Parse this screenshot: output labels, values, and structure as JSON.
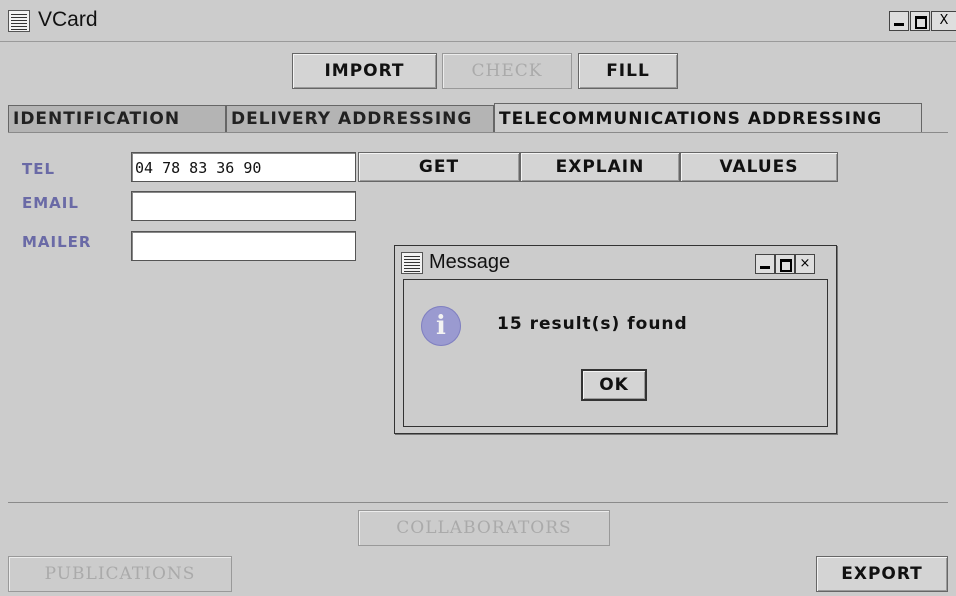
{
  "window": {
    "title": "VCard",
    "controls": [
      "_",
      "□",
      "X"
    ]
  },
  "toolbar": {
    "import": "IMPORT",
    "check": "CHECK",
    "fill": "FILL"
  },
  "tabs": [
    {
      "label": "IDENTIFICATION",
      "active": false
    },
    {
      "label": "DELIVERY ADDRESSING",
      "active": false
    },
    {
      "label": "TELECOMMUNICATIONS ADDRESSING",
      "active": true
    }
  ],
  "form": {
    "tel": {
      "label": "TEL",
      "value": "04 78 83 36 90"
    },
    "email": {
      "label": "EMAIL",
      "value": ""
    },
    "mailer": {
      "label": "MAILER",
      "value": ""
    },
    "actions": {
      "get": "GET",
      "explain": "EXPLAIN",
      "values": "VALUES"
    }
  },
  "dialog": {
    "title": "Message",
    "icon": "info-icon",
    "icon_glyph": "i",
    "message": "15 result(s) found",
    "ok": "OK"
  },
  "footer": {
    "collaborators": "COLLABORATORS",
    "publications": "PUBLICATIONS",
    "export": "EXPORT"
  },
  "colors": {
    "background": "#cccccc",
    "label": "#6a6aa6",
    "disabled_text": "#aaaaaa",
    "info_icon": "#9a9ad0"
  }
}
